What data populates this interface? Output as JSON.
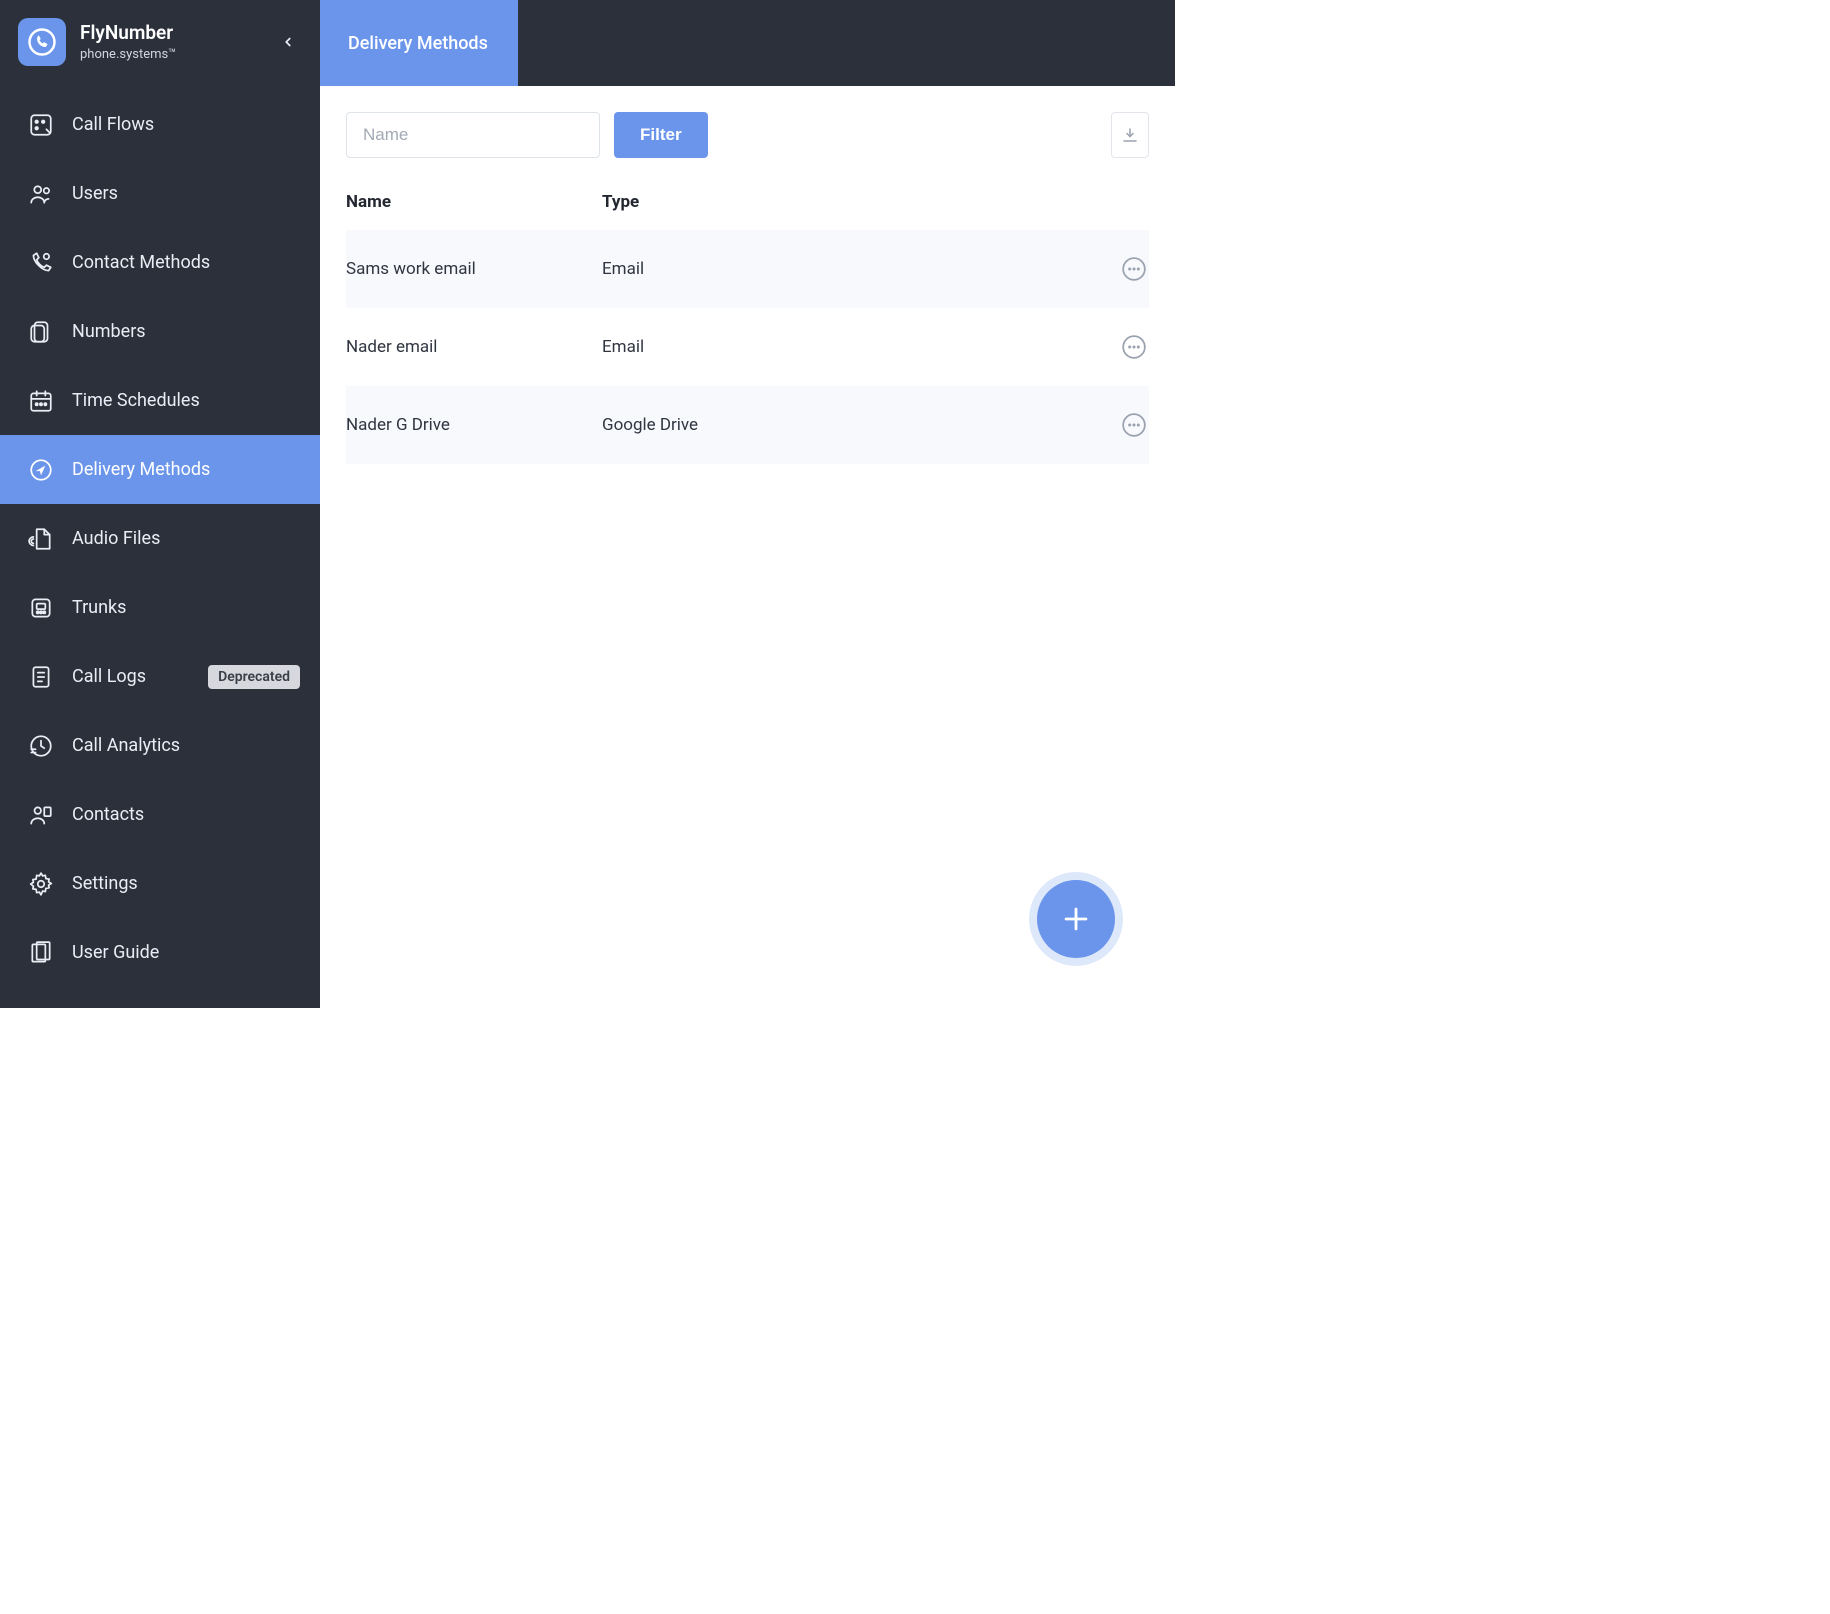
{
  "brand": {
    "title": "FlyNumber",
    "subtitle": "phone.systems™"
  },
  "sidebar": {
    "items": [
      {
        "label": "Call Flows",
        "icon": "call-flows-icon"
      },
      {
        "label": "Users",
        "icon": "users-icon"
      },
      {
        "label": "Contact Methods",
        "icon": "contact-methods-icon"
      },
      {
        "label": "Numbers",
        "icon": "numbers-icon"
      },
      {
        "label": "Time Schedules",
        "icon": "time-schedules-icon"
      },
      {
        "label": "Delivery Methods",
        "icon": "delivery-methods-icon",
        "active": true
      },
      {
        "label": "Audio Files",
        "icon": "audio-files-icon"
      },
      {
        "label": "Trunks",
        "icon": "trunks-icon"
      },
      {
        "label": "Call Logs",
        "icon": "call-logs-icon",
        "badge": "Deprecated"
      },
      {
        "label": "Call Analytics",
        "icon": "call-analytics-icon"
      },
      {
        "label": "Contacts",
        "icon": "contacts-icon"
      },
      {
        "label": "Settings",
        "icon": "settings-icon"
      },
      {
        "label": "User Guide",
        "icon": "user-guide-icon"
      }
    ]
  },
  "header": {
    "tab": "Delivery Methods"
  },
  "filter": {
    "placeholder": "Name",
    "value": "",
    "button": "Filter"
  },
  "table": {
    "columns": {
      "name": "Name",
      "type": "Type"
    },
    "rows": [
      {
        "name": "Sams work email",
        "type": "Email"
      },
      {
        "name": "Nader email",
        "type": "Email"
      },
      {
        "name": "Nader G Drive",
        "type": "Google Drive"
      }
    ]
  }
}
